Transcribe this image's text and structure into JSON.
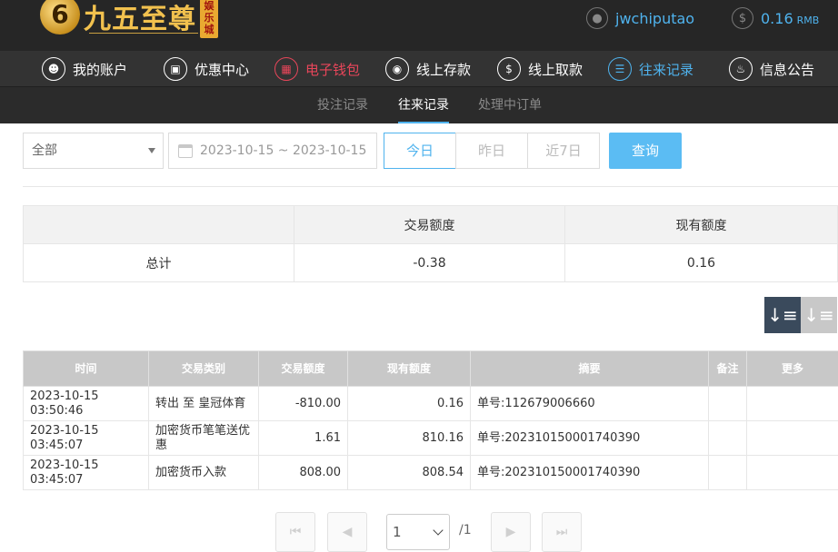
{
  "header": {
    "logo_badge": "6",
    "logo_text": "九五至尊",
    "logo_tag": "娱乐城",
    "username": "jwchiputao",
    "balance": "0.16",
    "balance_unit": "RMB"
  },
  "nav": {
    "items": [
      {
        "label": "我的账户",
        "icon": "user-icon"
      },
      {
        "label": "优惠中心",
        "icon": "gift-icon"
      },
      {
        "label": "电子钱包",
        "icon": "wallet-icon"
      },
      {
        "label": "线上存款",
        "icon": "deposit-icon"
      },
      {
        "label": "线上取款",
        "icon": "withdraw-icon"
      },
      {
        "label": "往来记录",
        "icon": "records-icon"
      },
      {
        "label": "信息公告",
        "icon": "bell-icon"
      }
    ]
  },
  "subnav": {
    "items": [
      {
        "label": "投注记录"
      },
      {
        "label": "往来记录"
      },
      {
        "label": "处理中订单"
      }
    ],
    "active": "往来记录"
  },
  "filters": {
    "type_select": "全部",
    "date_range": "2023-10-15 ~ 2023-10-15",
    "ranges": [
      "今日",
      "昨日",
      "近7日"
    ],
    "active_range": "今日",
    "query_label": "查询"
  },
  "summary": {
    "headers": [
      "",
      "交易额度",
      "现有额度"
    ],
    "row": {
      "label": "总计",
      "amount": "-0.38",
      "balance": "0.16"
    }
  },
  "table": {
    "headers": [
      "时间",
      "交易类别",
      "交易额度",
      "现有额度",
      "摘要",
      "备注",
      "更多"
    ],
    "rows": [
      {
        "time": "2023-10-15 03:50:46",
        "type": "转出 至 皇冠体育",
        "amount": "-810.00",
        "balance": "0.16",
        "summary": "单号:112679006660",
        "note": "",
        "more": ""
      },
      {
        "time": "2023-10-15 03:45:07",
        "type": "加密货币笔笔送优惠",
        "amount": "1.61",
        "balance": "810.16",
        "summary": "单号:202310150001740390",
        "note": "",
        "more": ""
      },
      {
        "time": "2023-10-15 03:45:07",
        "type": "加密货币入款",
        "amount": "808.00",
        "balance": "808.54",
        "summary": "单号:202310150001740390",
        "note": "",
        "more": ""
      }
    ]
  },
  "pagination": {
    "first": "⏮",
    "prev": "◀",
    "next": "▶",
    "last": "⏭",
    "current_page": "1",
    "total": "/1"
  },
  "colors": {
    "accent": "#4fb3ee",
    "highlight_red": "#e8465a",
    "header_bg": "#262626",
    "table_header_bg": "#c8c8c8"
  }
}
